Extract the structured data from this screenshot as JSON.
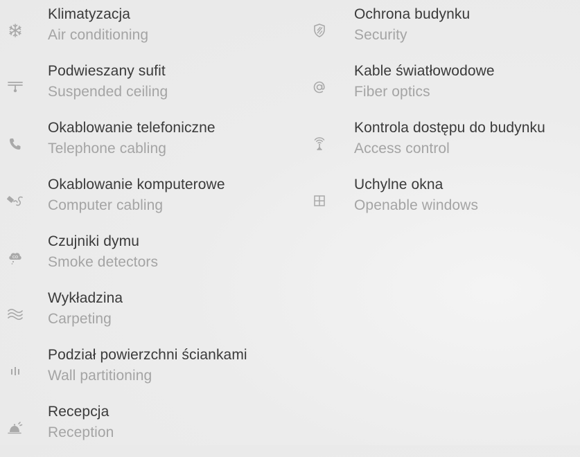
{
  "features_left": [
    {
      "icon": "snowflake-icon",
      "title": "Klimatyzacja",
      "subtitle": "Air conditioning"
    },
    {
      "icon": "ceiling-lamp-icon",
      "title": "Podwieszany sufit",
      "subtitle": "Suspended ceiling"
    },
    {
      "icon": "phone-icon",
      "title": "Okablowanie telefoniczne",
      "subtitle": "Telephone cabling"
    },
    {
      "icon": "network-cable-icon",
      "title": "Okablowanie komputerowe",
      "subtitle": "Computer cabling"
    },
    {
      "icon": "smoke-detector-icon",
      "title": "Czujniki dymu",
      "subtitle": "Smoke detectors"
    },
    {
      "icon": "waves-icon",
      "title": "Wykładzina",
      "subtitle": "Carpeting"
    },
    {
      "icon": "partition-icon",
      "title": "Podział powierzchni ściankami",
      "subtitle": "Wall partitioning"
    },
    {
      "icon": "reception-bell-icon",
      "title": "Recepcja",
      "subtitle": "Reception"
    }
  ],
  "features_right": [
    {
      "icon": "shield-icon",
      "title": "Ochrona budynku",
      "subtitle": "Security"
    },
    {
      "icon": "at-sign-icon",
      "title": "Kable światłowodowe",
      "subtitle": "Fiber optics"
    },
    {
      "icon": "antenna-icon",
      "title": "Kontrola dostępu do budynku",
      "subtitle": "Access control"
    },
    {
      "icon": "window-icon",
      "title": "Uchylne okna",
      "subtitle": "Openable windows"
    }
  ],
  "co_label": "CO"
}
